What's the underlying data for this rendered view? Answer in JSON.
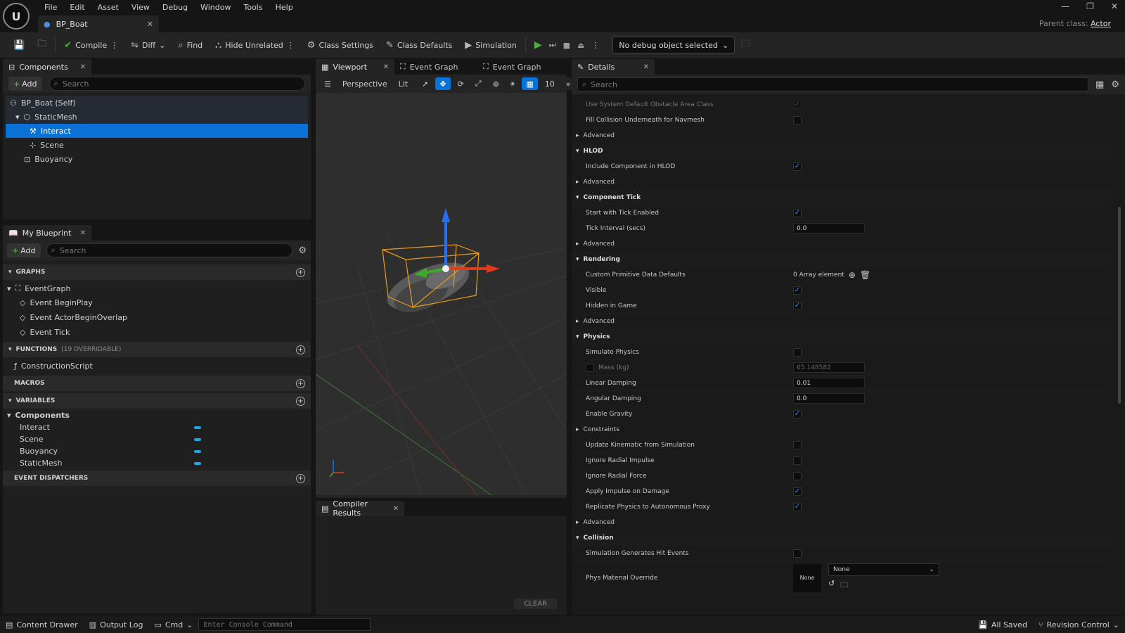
{
  "menu": [
    "File",
    "Edit",
    "Asset",
    "View",
    "Debug",
    "Window",
    "Tools",
    "Help"
  ],
  "doc_tab": "BP_Boat",
  "parent_class_label": "Parent class:",
  "parent_class_value": "Actor",
  "toolbar": {
    "compile": "Compile",
    "diff": "Diff",
    "find": "Find",
    "hide_unrelated": "Hide Unrelated",
    "class_settings": "Class Settings",
    "class_defaults": "Class Defaults",
    "simulation": "Simulation",
    "debug_object": "No debug object selected"
  },
  "components_panel": {
    "title": "Components",
    "add": "Add",
    "search_placeholder": "Search",
    "tree": [
      "BP_Boat (Self)",
      "StaticMesh",
      "Interact",
      "Scene",
      "Buoyancy"
    ]
  },
  "myblueprint_panel": {
    "title": "My Blueprint",
    "add": "Add",
    "search_placeholder": "Search",
    "graphs_header": "GRAPHS",
    "event_graph": "EventGraph",
    "events": [
      "Event BeginPlay",
      "Event ActorBeginOverlap",
      "Event Tick"
    ],
    "functions_header": "FUNCTIONS",
    "functions_count": "(19 OVERRIDABLE)",
    "construction_script": "ConstructionScript",
    "macros_header": "MACROS",
    "variables_header": "VARIABLES",
    "components_group": "Components",
    "variables": [
      "Interact",
      "Scene",
      "Buoyancy",
      "StaticMesh"
    ],
    "dispatchers_header": "EVENT DISPATCHERS"
  },
  "center_tabs": [
    "Viewport",
    "Event Graph",
    "Event Graph"
  ],
  "viewport": {
    "perspective": "Perspective",
    "lit": "Lit",
    "grid_snap": "10"
  },
  "compiler": {
    "title": "Compiler Results",
    "clear": "CLEAR"
  },
  "details": {
    "title": "Details",
    "search_placeholder": "Search",
    "rows": {
      "use_sys_default": "Use System Default Obstacle Area Class",
      "fill_collision": "Fill Collision Underneath for Navmesh",
      "advanced": "Advanced",
      "hlod": "HLOD",
      "include_hlod": "Include Component in HLOD",
      "component_tick": "Component Tick",
      "start_tick": "Start with Tick Enabled",
      "tick_interval": "Tick Interval (secs)",
      "tick_interval_val": "0.0",
      "rendering": "Rendering",
      "custom_primitive": "Custom Primitive Data Defaults",
      "array_element": "0 Array element",
      "visible": "Visible",
      "hidden_in_game": "Hidden in Game",
      "physics": "Physics",
      "simulate_physics": "Simulate Physics",
      "mass": "Mass (kg)",
      "mass_val": "65.148582",
      "linear_damping": "Linear Damping",
      "linear_damping_val": "0.01",
      "angular_damping": "Angular Damping",
      "angular_damping_val": "0.0",
      "enable_gravity": "Enable Gravity",
      "constraints": "Constraints",
      "update_kinematic": "Update Kinematic from Simulation",
      "ignore_radial_impulse": "Ignore Radial Impulse",
      "ignore_radial_force": "Ignore Radial Force",
      "apply_impulse": "Apply Impulse on Damage",
      "replicate_physics": "Replicate Physics to Autonomous Proxy",
      "collision": "Collision",
      "sim_hit_events": "Simulation Generates Hit Events",
      "phys_material": "Phys Material Override",
      "phys_material_thumb": "None",
      "phys_material_val": "None"
    }
  },
  "statusbar": {
    "content_drawer": "Content Drawer",
    "output_log": "Output Log",
    "cmd": "Cmd",
    "console_placeholder": "Enter Console Command",
    "all_saved": "All Saved",
    "revision_control": "Revision Control"
  }
}
